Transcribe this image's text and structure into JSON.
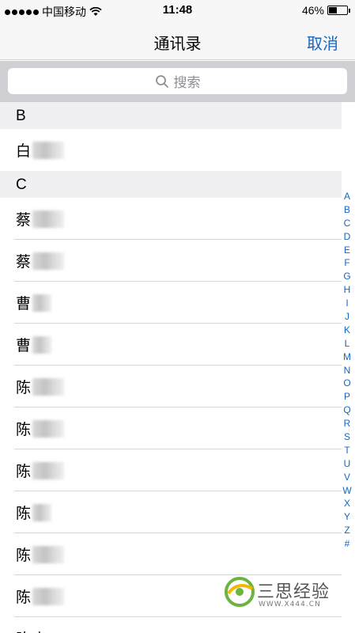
{
  "status_bar": {
    "carrier": "中国移动",
    "time": "11:48",
    "battery": "46%",
    "battery_level": 0.46
  },
  "nav": {
    "title": "通讯录",
    "cancel_label": "取消"
  },
  "search": {
    "placeholder": "搜索"
  },
  "sections": [
    {
      "letter": "B",
      "contacts": [
        "白"
      ]
    },
    {
      "letter": "C",
      "contacts": [
        "蔡",
        "蔡",
        "曹",
        "曹",
        "陈",
        "陈",
        "陈",
        "陈",
        "陈",
        "陈",
        "陈欢"
      ]
    }
  ],
  "index_letters": [
    "A",
    "B",
    "C",
    "D",
    "E",
    "F",
    "G",
    "H",
    "I",
    "J",
    "K",
    "L",
    "M",
    "N",
    "O",
    "P",
    "Q",
    "R",
    "S",
    "T",
    "U",
    "V",
    "W",
    "X",
    "Y",
    "Z",
    "#"
  ],
  "watermark": {
    "text": "三思经验",
    "url": "WWW.X444.CN"
  },
  "colors": {
    "accent": "#1566c6",
    "section_bg": "#f0f0f2",
    "search_area_bg": "#d0d0d4"
  }
}
